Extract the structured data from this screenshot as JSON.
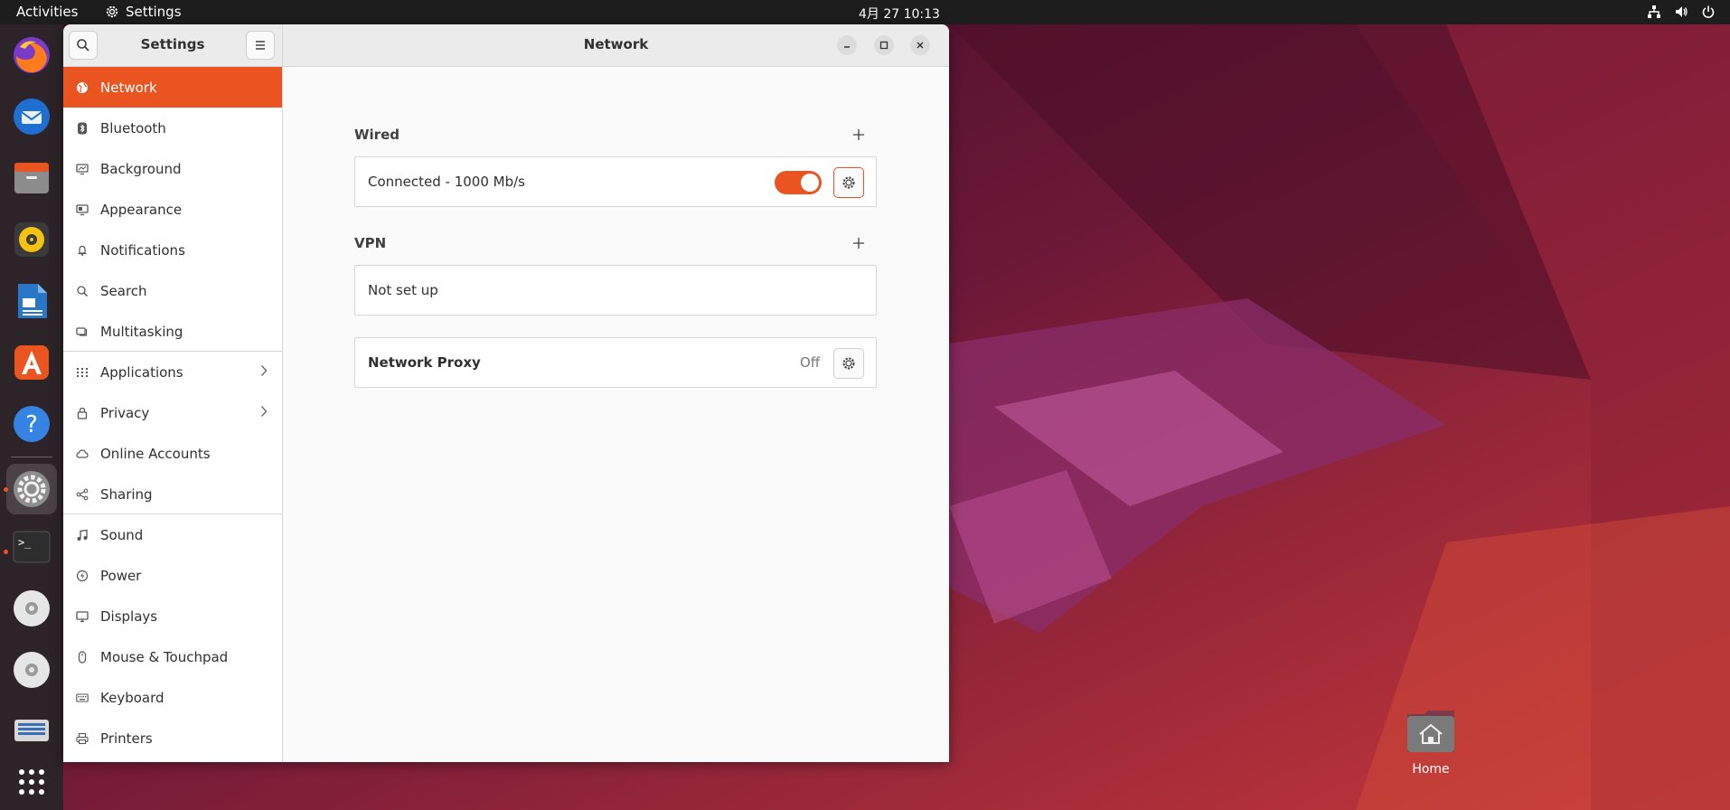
{
  "topbar": {
    "activities": "Activities",
    "app_name": "Settings",
    "clock": "4月 27  10:13"
  },
  "dock": {
    "items": [
      {
        "name": "firefox-icon"
      },
      {
        "name": "thunderbird-icon"
      },
      {
        "name": "files-icon"
      },
      {
        "name": "rhythmbox-icon"
      },
      {
        "name": "writer-icon"
      },
      {
        "name": "app-center-icon"
      },
      {
        "name": "help-icon"
      },
      {
        "name": "settings-icon"
      },
      {
        "name": "terminal-icon"
      },
      {
        "name": "disc-icon"
      },
      {
        "name": "disc-icon"
      },
      {
        "name": "scanner-icon"
      },
      {
        "name": "show-apps-icon"
      }
    ],
    "terminal_prompt": ">_"
  },
  "window": {
    "sidebar_title": "Settings",
    "title": "Network"
  },
  "sidebar": {
    "items": [
      {
        "label": "Network",
        "icon": "globe-icon",
        "active": true
      },
      {
        "label": "Bluetooth",
        "icon": "bluetooth-icon"
      },
      {
        "label": "Background",
        "icon": "monitor-icon"
      },
      {
        "label": "Appearance",
        "icon": "appearance-icon"
      },
      {
        "label": "Notifications",
        "icon": "bell-icon"
      },
      {
        "label": "Search",
        "icon": "search-icon"
      },
      {
        "label": "Multitasking",
        "icon": "multitasking-icon"
      },
      {
        "label": "Applications",
        "icon": "grid-icon",
        "has_submenu": true
      },
      {
        "label": "Privacy",
        "icon": "lock-icon",
        "has_submenu": true
      },
      {
        "label": "Online Accounts",
        "icon": "cloud-icon"
      },
      {
        "label": "Sharing",
        "icon": "share-icon"
      },
      {
        "label": "Sound",
        "icon": "music-note-icon"
      },
      {
        "label": "Power",
        "icon": "power-bolt-icon"
      },
      {
        "label": "Displays",
        "icon": "display-icon"
      },
      {
        "label": "Mouse & Touchpad",
        "icon": "mouse-icon"
      },
      {
        "label": "Keyboard",
        "icon": "keyboard-icon"
      },
      {
        "label": "Printers",
        "icon": "printer-icon"
      }
    ]
  },
  "content": {
    "wired": {
      "title": "Wired",
      "status": "Connected - 1000 Mb/s",
      "enabled": true
    },
    "vpn": {
      "title": "VPN",
      "status": "Not set up"
    },
    "proxy": {
      "label": "Network Proxy",
      "status": "Off"
    }
  },
  "desktop": {
    "home_label": "Home"
  },
  "colors": {
    "accent": "#e95420",
    "topbar": "#1d1d1d",
    "dock": "#2c2428"
  }
}
